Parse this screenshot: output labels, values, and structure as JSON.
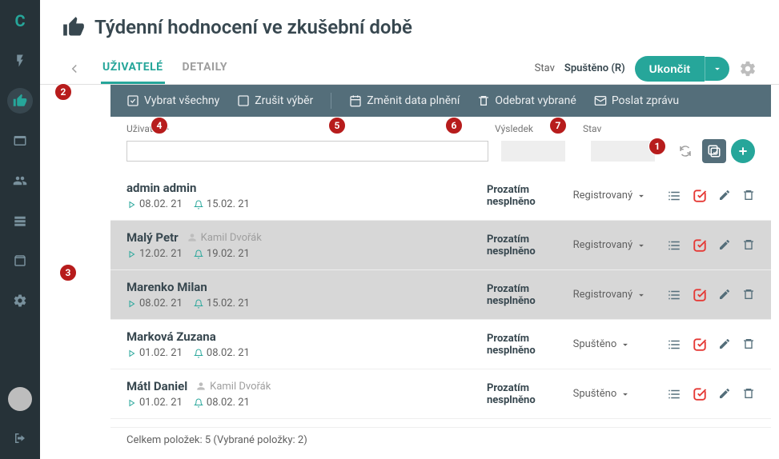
{
  "sidebar": {
    "logo": "C"
  },
  "header": {
    "title": "Týdenní hodnocení ve zkušební době"
  },
  "tabs": {
    "users": "UŽIVATELÉ",
    "details": "DETAILY"
  },
  "statebar": {
    "label": "Stav",
    "value": "Spuštěno (R)",
    "end_btn": "Ukončit"
  },
  "toolbar": {
    "select_all": "Vybrat všechny",
    "deselect": "Zrušit výběr",
    "change_dates": "Změnit data plnění",
    "remove_selected": "Odebrat vybrané",
    "send_msg": "Poslat zprávu"
  },
  "columns": {
    "user": "Uživatel",
    "result": "Výsledek",
    "state": "Stav"
  },
  "result_label": "Prozatím nesplněno",
  "rows": [
    {
      "name": "admin admin",
      "assignee": "",
      "date1": "08.02. 21",
      "date2": "15.02. 21",
      "state": "Registrovaný",
      "selected": false
    },
    {
      "name": "Malý Petr",
      "assignee": "Kamil Dvořák",
      "date1": "12.02. 21",
      "date2": "19.02. 21",
      "state": "Registrovaný",
      "selected": true
    },
    {
      "name": "Marenko Milan",
      "assignee": "",
      "date1": "08.02. 21",
      "date2": "15.02. 21",
      "state": "Registrovaný",
      "selected": true
    },
    {
      "name": "Marková Zuzana",
      "assignee": "",
      "date1": "01.02. 21",
      "date2": "08.02. 21",
      "state": "Spuštěno",
      "selected": false
    },
    {
      "name": "Mátl Daniel",
      "assignee": "Kamil Dvořák",
      "date1": "01.02. 21",
      "date2": "08.02. 21",
      "state": "Spuštěno",
      "selected": false
    }
  ],
  "footer": "Celkem položek: 5 (Vybrané položky: 2)",
  "markers": {
    "m1": "1",
    "m2": "2",
    "m3": "3",
    "m4": "4",
    "m5": "5",
    "m6": "6",
    "m7": "7"
  }
}
